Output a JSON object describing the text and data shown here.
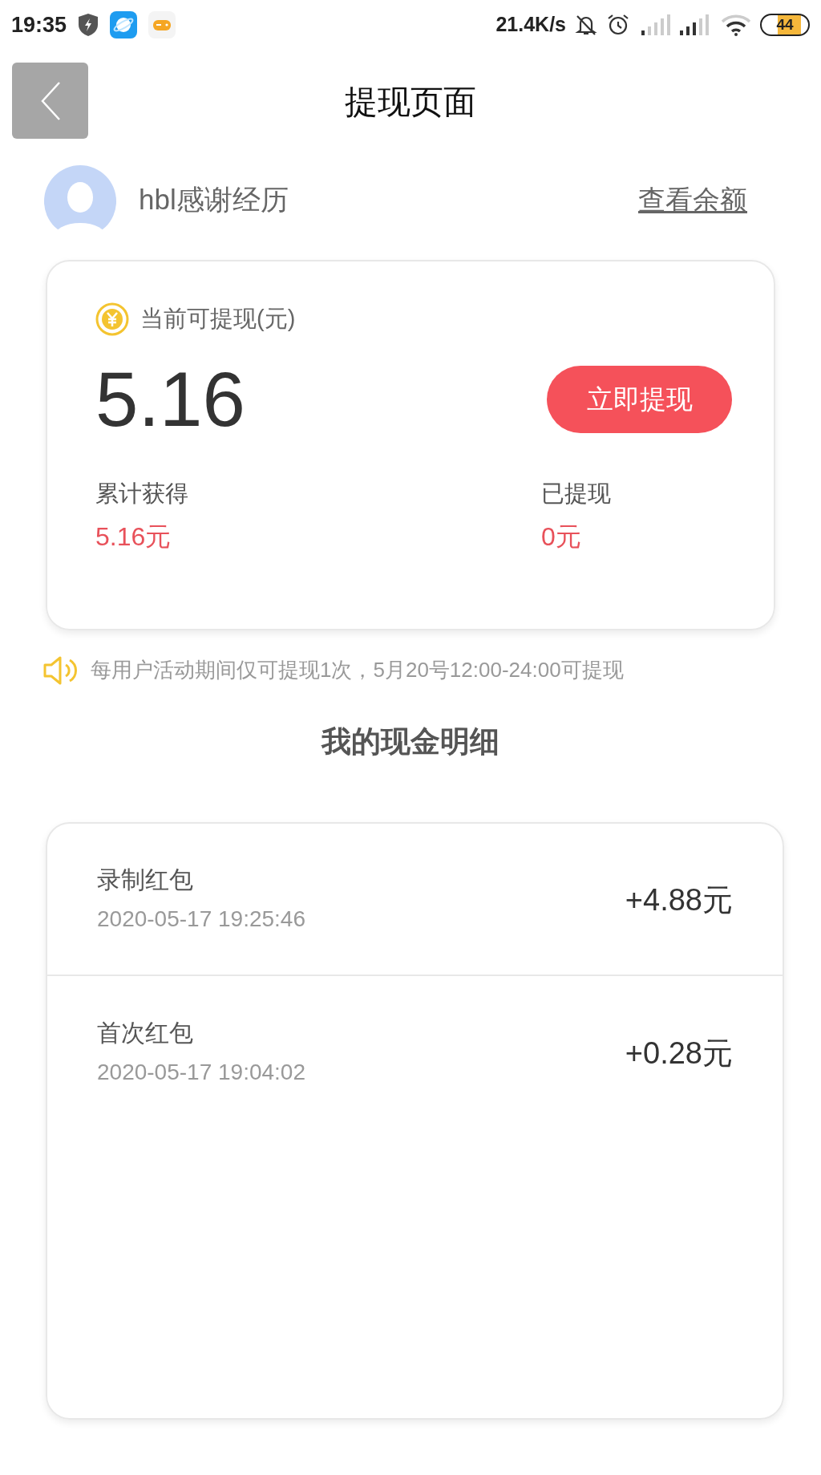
{
  "status_bar": {
    "time": "19:35",
    "network_speed": "21.4K/s",
    "battery": "44"
  },
  "header": {
    "title": "提现页面"
  },
  "user": {
    "name": "hbl感谢经历",
    "balance_link": "查看余额"
  },
  "balance_card": {
    "label": "当前可提现(元)",
    "amount": "5.16",
    "button": "立即提现",
    "stats": [
      {
        "label": "累计获得",
        "value": "5.16元"
      },
      {
        "label": "已提现",
        "value": "0元"
      }
    ]
  },
  "notice": "每用户活动期间仅可提现1次，5月20号12:00-24:00可提现",
  "section_title": "我的现金明细",
  "transactions": [
    {
      "title": "录制红包",
      "time": "2020-05-17 19:25:46",
      "amount": "+4.88元"
    },
    {
      "title": "首次红包",
      "time": "2020-05-17 19:04:02",
      "amount": "+0.28元"
    }
  ]
}
